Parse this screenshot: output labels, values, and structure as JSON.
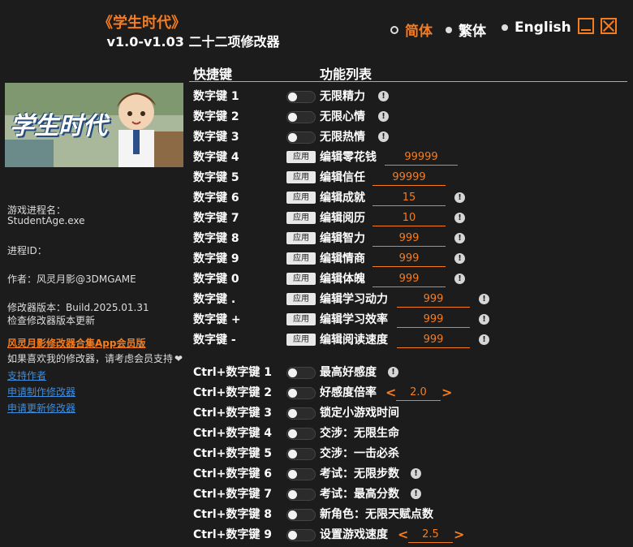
{
  "header": {
    "title": "《学生时代》",
    "subtitle": "v1.0-v1.03 二十二项修改器"
  },
  "languages": [
    {
      "label": "简体",
      "selected": true
    },
    {
      "label": "繁体",
      "selected": false
    },
    {
      "label": "English",
      "selected": false
    }
  ],
  "columns": {
    "hotkey": "快捷键",
    "features": "功能列表"
  },
  "banner": {
    "text": "学生时代"
  },
  "sidebar": {
    "process_label": "游戏进程名：",
    "process_value": "StudentAge.exe",
    "pid_label": "进程ID：",
    "author": "作者：风灵月影@3DMGAME",
    "version": "修改器版本：Build.2025.01.31",
    "check_update": "检查修改器版本更新",
    "vip_link": "风灵月影修改器合集App会员版",
    "support_text": "如果喜欢我的修改器，请考虑会员支持",
    "links": [
      "支持作者",
      "申请制作修改器",
      "申请更新修改器"
    ]
  },
  "apply_label": "应用",
  "rows": [
    {
      "key": "数字键 1",
      "label": "无限精力",
      "info": "!"
    },
    {
      "key": "数字键 2",
      "label": "无限心情",
      "info": "!"
    },
    {
      "key": "数字键 3",
      "label": "无限热情",
      "info": "!"
    },
    {
      "key": "数字键 4",
      "label": "编辑零花钱",
      "value": "99999"
    },
    {
      "key": "数字键 5",
      "label": "编辑信任",
      "value": "99999"
    },
    {
      "key": "数字键 6",
      "label": "编辑成就",
      "value": "15",
      "info": "!"
    },
    {
      "key": "数字键 7",
      "label": "编辑阅历",
      "value": "10",
      "info": "!"
    },
    {
      "key": "数字键 8",
      "label": "编辑智力",
      "value": "999",
      "info": "!"
    },
    {
      "key": "数字键 9",
      "label": "编辑情商",
      "value": "999",
      "info": "!"
    },
    {
      "key": "数字键 0",
      "label": "编辑体魄",
      "value": "999",
      "info": "!"
    },
    {
      "key": "数字键 .",
      "label": "编辑学习动力",
      "value": "999",
      "info": "!"
    },
    {
      "key": "数字键 +",
      "label": "编辑学习效率",
      "value": "999",
      "info": "!"
    },
    {
      "key": "数字键 -",
      "label": "编辑阅读速度",
      "value": "999",
      "info": "!"
    },
    {
      "key": "Ctrl+数字键 1",
      "label": "最高好感度",
      "info": "!"
    },
    {
      "key": "Ctrl+数字键 2",
      "label": "好感度倍率",
      "value": "2.0"
    },
    {
      "key": "Ctrl+数字键 3",
      "label": "锁定小游戏时间"
    },
    {
      "key": "Ctrl+数字键 4",
      "label": "交涉：无限生命"
    },
    {
      "key": "Ctrl+数字键 5",
      "label": "交涉：一击必杀"
    },
    {
      "key": "Ctrl+数字键 6",
      "label": "考试：无限步数",
      "info": "!"
    },
    {
      "key": "Ctrl+数字键 7",
      "label": "考试：最高分数",
      "info": "!"
    },
    {
      "key": "Ctrl+数字键 8",
      "label": "新角色：无限天赋点数"
    },
    {
      "key": "Ctrl+数字键 9",
      "label": "设置游戏速度",
      "value": "2.5"
    }
  ],
  "arrows": {
    "left": "<",
    "right": ">"
  },
  "colors": {
    "accent": "#f57c1f",
    "background": "#1c1c1c",
    "link": "#3d8de0"
  }
}
